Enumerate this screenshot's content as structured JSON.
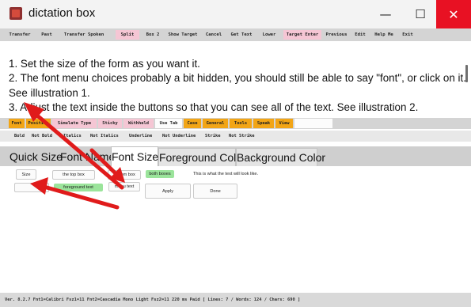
{
  "window": {
    "title": "dictation box",
    "minimize_glyph": "—",
    "maximize_glyph": "☐",
    "close_glyph": "✕"
  },
  "toolbar": {
    "items": [
      "Transfer",
      "Past",
      "Transfer Spoken",
      "Split",
      "Box 2",
      "Show Target",
      "Cancel",
      "Get Text",
      "Lower",
      "Target Enter",
      "Previous",
      "Edit",
      "Help Me",
      "Exit"
    ],
    "highlighted": [
      "Split",
      "Target Enter"
    ]
  },
  "instructions": {
    "line1": "1. Set the size of the form as you want it.",
    "line2": "2. The font menu choices probably a bit hidden, you should still be able to say \"font\", or click on it. See illustration 1.",
    "line3": "3. Adjust the text inside the buttons so that you can see all of the text. See illustration 2."
  },
  "menu_bar": {
    "items": [
      "Font",
      "Position",
      "Simulate Type",
      "Sticky",
      "Withheld",
      "Use Tab",
      "Case",
      "General",
      "Tools",
      "Speak",
      "View"
    ],
    "orange": [
      "Font",
      "Position",
      "Case",
      "General",
      "Tools",
      "Speak",
      "View"
    ],
    "pink": [
      "Simulate Type",
      "Sticky",
      "Withheld"
    ],
    "white": [
      "Use Tab"
    ]
  },
  "font_style_bar": {
    "items": [
      "Bold",
      "Not Bold",
      "Italics",
      "Not Italics",
      "Underline",
      "Not Underline",
      "Strike",
      "Not Strike"
    ]
  },
  "tabs": {
    "items": [
      "Quick Size",
      "Font Name",
      "Font Size",
      "Foreground Color",
      "Background Color"
    ],
    "active": "Font Size"
  },
  "panel": {
    "size_label": "Size",
    "top_box": "the top box",
    "bottom_box": "bottom box",
    "both_boxes": "both boxes",
    "preview_text": "This is what the text will look like.",
    "size_value": "",
    "foreground_text": "foreground text",
    "menu_text": "menu text",
    "apply": "Apply",
    "done": "Done"
  },
  "status_bar": {
    "text": "Ver. 8.2.7  Fnt1=Calibri  Fsz1=11  Fnt2=Cascadia Mono Light  Fsz2=11   220 ms Paid  [ Lines: 7 / Words: 124 / Chars: 690 ]"
  },
  "colors": {
    "toolbar_pink": "#f5c6d4",
    "menu_orange": "#f2a516",
    "green_button": "#9be49b",
    "close_red": "#e81123",
    "arrow_red": "#e01b1b"
  }
}
